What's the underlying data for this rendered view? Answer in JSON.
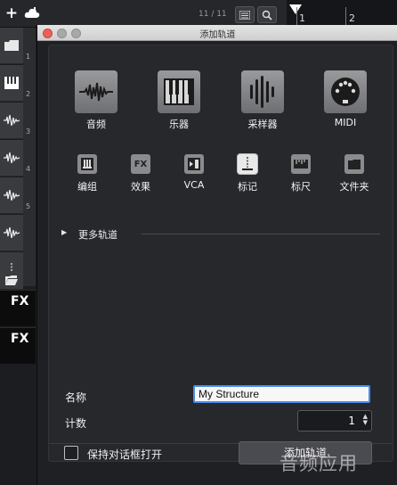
{
  "toolbar": {
    "add_icon": "plus-icon",
    "cloud_icon": "cloud-icon",
    "track_counter": "11 / 11",
    "list_icon": "list-icon",
    "search_icon": "search-icon",
    "ruler_marks": [
      "1",
      "2"
    ]
  },
  "tracks": {
    "items": [
      {
        "icon": "folder-icon",
        "num": ""
      },
      {
        "icon": "piano-icon",
        "num": "1"
      },
      {
        "icon": "waveform-icon",
        "num": "2"
      },
      {
        "icon": "waveform-icon",
        "num": "3"
      },
      {
        "icon": "waveform-icon",
        "num": "4"
      },
      {
        "icon": "waveform-icon",
        "num": "5"
      },
      {
        "icon": "marker-icon",
        "num": ""
      },
      {
        "icon": "folder-icon",
        "num": ""
      }
    ],
    "fx_label_1": "FX",
    "fx_label_2": "FX"
  },
  "dialog": {
    "title": "添加轨道",
    "categories_main": [
      {
        "label": "音频",
        "icon": "audio-waveform-icon"
      },
      {
        "label": "乐器",
        "icon": "keyboard-icon"
      },
      {
        "label": "采样器",
        "icon": "sampler-icon"
      },
      {
        "label": "MIDI",
        "icon": "midi-port-icon"
      }
    ],
    "categories_secondary": [
      {
        "label": "编组",
        "icon": "group-icon",
        "glyph": ""
      },
      {
        "label": "效果",
        "icon": "fx-icon",
        "glyph": "FX"
      },
      {
        "label": "VCA",
        "icon": "vca-icon",
        "glyph": ""
      },
      {
        "label": "标记",
        "icon": "marker-icon",
        "glyph": ""
      },
      {
        "label": "标尺",
        "icon": "ruler-icon",
        "glyph": ""
      },
      {
        "label": "文件夹",
        "icon": "folder-icon",
        "glyph": ""
      }
    ],
    "more_tracks_label": "更多轨道",
    "name_label": "名称",
    "name_value": "My Structure",
    "count_label": "计数",
    "count_value": "1",
    "keep_open_label": "保持对话框打开",
    "add_button_label": "添加轨道"
  },
  "watermark": "音频应用",
  "colors": {
    "focus_ring": "#4a8bf2",
    "close_dot": "#ed5f57",
    "inactive_dot": "#a8a8a8"
  }
}
